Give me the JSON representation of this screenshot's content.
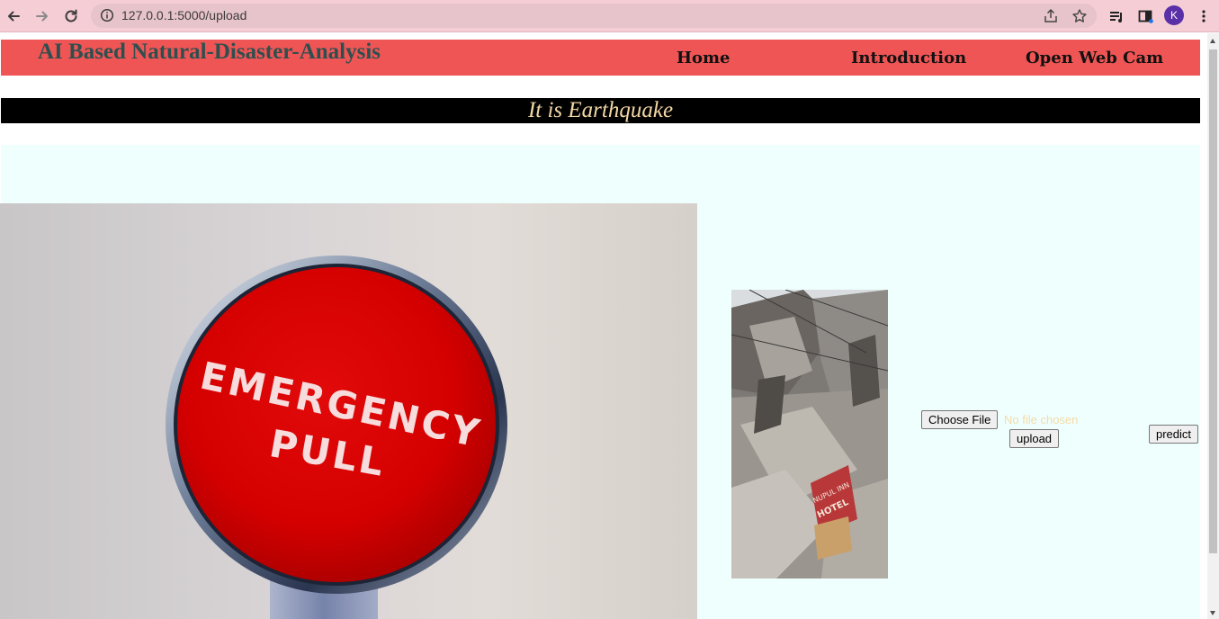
{
  "browser": {
    "url": "127.0.0.1:5000/upload",
    "profile_initial": "K",
    "icons": [
      "back-arrow-icon",
      "forward-arrow-icon",
      "reload-icon",
      "info-icon",
      "share-icon",
      "star-icon",
      "reading-list-icon",
      "side-panel-icon",
      "kebab-menu-icon"
    ],
    "colors": {
      "toolbar": "#f5cdd5",
      "omnibox": "#e7c3cb",
      "avatar": "#5a2fa8"
    }
  },
  "navbar": {
    "brand": "AI Based Natural-Disaster-Analysis",
    "links": [
      "Home",
      "Introduction",
      "Open Web Cam"
    ],
    "background": "#ef5555"
  },
  "result": {
    "text": "It is Earthquake"
  },
  "hero_image": {
    "text_line1": "EMERGENCY",
    "text_line2": "PULL"
  },
  "upload_form": {
    "choose_file_label": "Choose File",
    "no_file_text": "No file chosen",
    "upload_label": "upload",
    "predict_label": "predict"
  },
  "uploaded_photo": {
    "sign_text_1": "NUPUL INN",
    "sign_text_2": "HOTEL"
  }
}
